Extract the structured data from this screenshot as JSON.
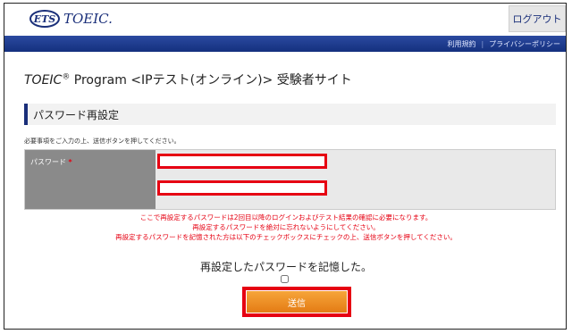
{
  "header": {
    "logo_badge": "ETS",
    "logo_text": "TOEIC.",
    "logout_label": "ログアウト"
  },
  "nav": {
    "links": [
      "利用規約",
      "プライバシーポリシー"
    ],
    "separator": "|"
  },
  "page": {
    "title_prefix": "TOEIC",
    "title_mark": "®",
    "title_rest": "Program <IPテスト(オンライン)> 受験者サイト"
  },
  "section": {
    "title": "パスワード再設定"
  },
  "instructions": "必要事項をご入力の上、送信ボタンを押してください。",
  "form": {
    "password_label": "パスワード",
    "required_mark": "*",
    "password_value": "",
    "confirm_value": ""
  },
  "notices": [
    "ここで再設定するパスワードは2回目以降のログインおよびテスト結果の確認に必要になります。",
    "再設定するパスワードを絶対に忘れないようにしてください。",
    "再設定するパスワードを記憶された方は以下のチェックボックスにチェックの上、送信ボタンを押してください。"
  ],
  "remember": {
    "label": "再設定したパスワードを記憶した。",
    "checked": false
  },
  "submit": {
    "label": "送信"
  },
  "colors": {
    "brand_navy": "#1a2f7a",
    "highlight_red": "#e60012",
    "button_orange": "#ee8f25"
  }
}
